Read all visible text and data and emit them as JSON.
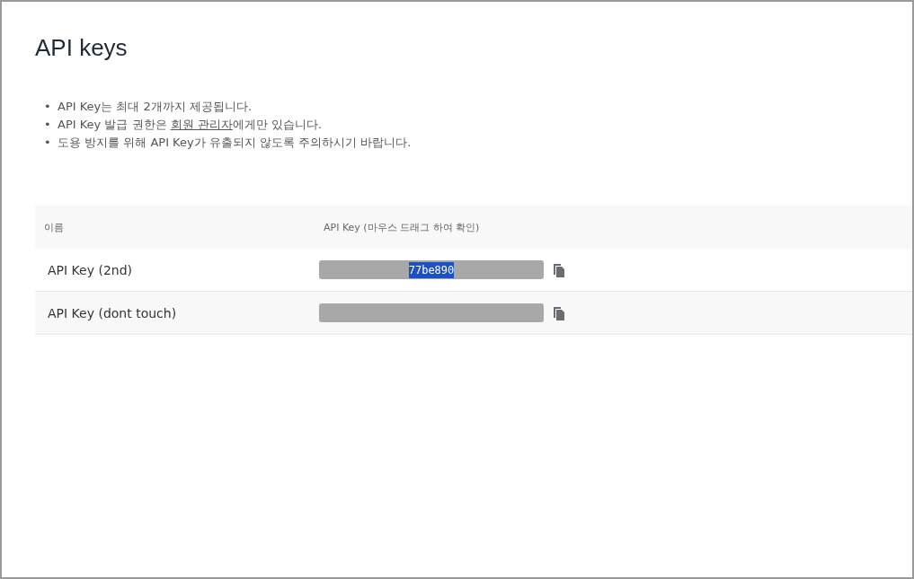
{
  "title": "API keys",
  "notes": [
    {
      "marker": "•",
      "parts": [
        {
          "kind": "text",
          "text": "API Key는 최대 2개까지 제공됩니다."
        }
      ]
    },
    {
      "marker": "•",
      "parts": [
        {
          "kind": "text",
          "text": "API Key 발급 권한은 "
        },
        {
          "kind": "link",
          "text": "회원 관리자"
        },
        {
          "kind": "text",
          "text": "에게만 있습니다."
        }
      ]
    },
    {
      "marker": "•",
      "parts": [
        {
          "kind": "text",
          "text": "도용 방지를 위해 API Key가 유출되지 않도록 주의하시기 바랍니다."
        }
      ]
    }
  ],
  "table": {
    "columns": [
      "이름",
      "API Key (마우스 드래그 하여 확인)"
    ],
    "rows": [
      {
        "name": "API Key (2nd)",
        "selected_text": "77be890"
      },
      {
        "name": "API Key (dont touch)"
      }
    ]
  }
}
